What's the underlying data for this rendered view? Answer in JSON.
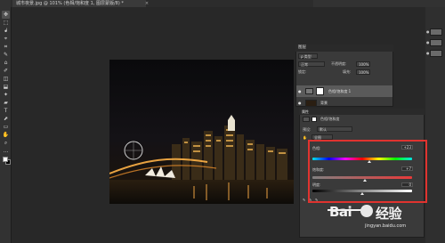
{
  "document": {
    "tab_title": "城市夜景.jpg @ 101% (色相/饱和度 1, 图层蒙版/8) *",
    "close_glyph": "×"
  },
  "tools": [
    "✥",
    "⬚",
    "ᖱ",
    "⌖",
    "⌗",
    "✎",
    "⌂",
    "✐",
    "◫",
    "⬓",
    "✦",
    "▰",
    "T",
    "⬈",
    "▭",
    "✋",
    "⌕",
    "…"
  ],
  "layers_panel": {
    "title": "图层",
    "filter_label": "ρ 类型",
    "blend_mode": "正常",
    "opacity_label": "不透明度:",
    "opacity_value": "100%",
    "lock_label": "锁定:",
    "fill_label": "填充:",
    "fill_value": "100%",
    "adjustment_layer_name": "色相/饱和度 1",
    "background_layer_name": "背景"
  },
  "properties_panel": {
    "title": "属性",
    "subtitle": "色相/饱和度",
    "preset_label": "预设:",
    "preset_value": "默认",
    "channel_value": "全图",
    "hue_label": "色相:",
    "hue_value": "+23",
    "hue_position": 0.57,
    "saturation_label": "饱和度:",
    "saturation_value": "+7",
    "saturation_position": 0.53,
    "lightness_label": "明度:",
    "lightness_value": "0",
    "lightness_position": 0.5,
    "colorize_label": "着色"
  },
  "watermark": {
    "brand": "Bai",
    "brand2": "经验",
    "url": "jingyan.baidu.com"
  },
  "colors": {
    "highlight_box": "#e0332f"
  }
}
